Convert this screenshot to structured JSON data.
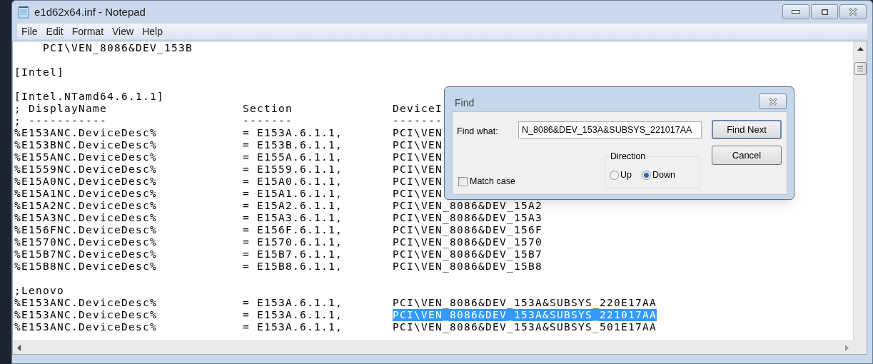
{
  "window": {
    "title": "e1d62x64.inf - Notepad"
  },
  "menu": [
    "File",
    "Edit",
    "Format",
    "View",
    "Help"
  ],
  "lines": [
    {
      "kind": "text",
      "cells": [
        "    PCI\\VEN_8086&DEV_153B"
      ],
      "selected": false
    },
    {
      "kind": "blank"
    },
    {
      "kind": "text",
      "cells": [
        "[Intel]"
      ],
      "selected": false
    },
    {
      "kind": "blank"
    },
    {
      "kind": "text",
      "cells": [
        "[Intel.NTamd64.6.1.1]"
      ],
      "selected": false
    },
    {
      "kind": "text",
      "cells": [
        "; DisplayName",
        "Section",
        "DeviceI"
      ],
      "selected": false
    },
    {
      "kind": "text",
      "cells": [
        "; -----------",
        "-------",
        "-------"
      ],
      "selected": false
    },
    {
      "kind": "text",
      "cells": [
        "%E153ANC.DeviceDesc%",
        "= E153A.6.1.1,",
        "PCI\\VEN"
      ],
      "selected": false
    },
    {
      "kind": "text",
      "cells": [
        "%E153BNC.DeviceDesc%",
        "= E153B.6.1.1,",
        "PCI\\VEN"
      ],
      "selected": false
    },
    {
      "kind": "text",
      "cells": [
        "%E155ANC.DeviceDesc%",
        "= E155A.6.1.1,",
        "PCI\\VEN"
      ],
      "selected": false
    },
    {
      "kind": "text",
      "cells": [
        "%E1559NC.DeviceDesc%",
        "= E1559.6.1.1,",
        "PCI\\VEN"
      ],
      "selected": false
    },
    {
      "kind": "text",
      "cells": [
        "%E15A0NC.DeviceDesc%",
        "= E15A0.6.1.1,",
        "PCI\\VEN"
      ],
      "selected": false
    },
    {
      "kind": "text",
      "cells": [
        "%E15A1NC.DeviceDesc%",
        "= E15A1.6.1.1,",
        "PCI\\VEN"
      ],
      "selected": false
    },
    {
      "kind": "text",
      "cells": [
        "%E15A2NC.DeviceDesc%",
        "= E15A2.6.1.1,",
        "PCI\\VEN_8086&DEV_15A2"
      ],
      "selected": false
    },
    {
      "kind": "text",
      "cells": [
        "%E15A3NC.DeviceDesc%",
        "= E15A3.6.1.1,",
        "PCI\\VEN_8086&DEV_15A3"
      ],
      "selected": false
    },
    {
      "kind": "text",
      "cells": [
        "%E156FNC.DeviceDesc%",
        "= E156F.6.1.1,",
        "PCI\\VEN_8086&DEV_156F"
      ],
      "selected": false
    },
    {
      "kind": "text",
      "cells": [
        "%E1570NC.DeviceDesc%",
        "= E1570.6.1.1,",
        "PCI\\VEN_8086&DEV_1570"
      ],
      "selected": false
    },
    {
      "kind": "text",
      "cells": [
        "%E15B7NC.DeviceDesc%",
        "= E15B7.6.1.1,",
        "PCI\\VEN_8086&DEV_15B7"
      ],
      "selected": false
    },
    {
      "kind": "text",
      "cells": [
        "%E15B8NC.DeviceDesc%",
        "= E15B8.6.1.1,",
        "PCI\\VEN_8086&DEV_15B8"
      ],
      "selected": false
    },
    {
      "kind": "blank"
    },
    {
      "kind": "text",
      "cells": [
        ";Lenovo"
      ],
      "selected": false
    },
    {
      "kind": "text",
      "cells": [
        "%E153ANC.DeviceDesc%",
        "= E153A.6.1.1,",
        "PCI\\VEN_8086&DEV_153A&SUBSYS_220E17AA"
      ],
      "selected": false
    },
    {
      "kind": "text",
      "cells": [
        "%E153ANC.DeviceDesc%",
        "= E153A.6.1.1,",
        "PCI\\VEN_8086&DEV_153A&SUBSYS_221017AA"
      ],
      "selected": true
    },
    {
      "kind": "text",
      "cells": [
        "%E153ANC.DeviceDesc%",
        "= E153A.6.1.1,",
        "PCI\\VEN_8086&DEV_153A&SUBSYS_501E17AA"
      ],
      "selected": false
    }
  ],
  "find_dialog": {
    "title": "Find",
    "find_what": {
      "label": "Find what:",
      "value": "N_8086&DEV_153A&SUBSYS_221017AA"
    },
    "match_case": {
      "label": "Match case",
      "checked": false
    },
    "direction": {
      "label": "Direction",
      "options": [
        {
          "label": "Up",
          "selected": false
        },
        {
          "label": "Down",
          "selected": true
        }
      ]
    },
    "buttons": [
      {
        "label": "Find Next",
        "default": true
      },
      {
        "label": "Cancel",
        "default": false
      }
    ]
  }
}
